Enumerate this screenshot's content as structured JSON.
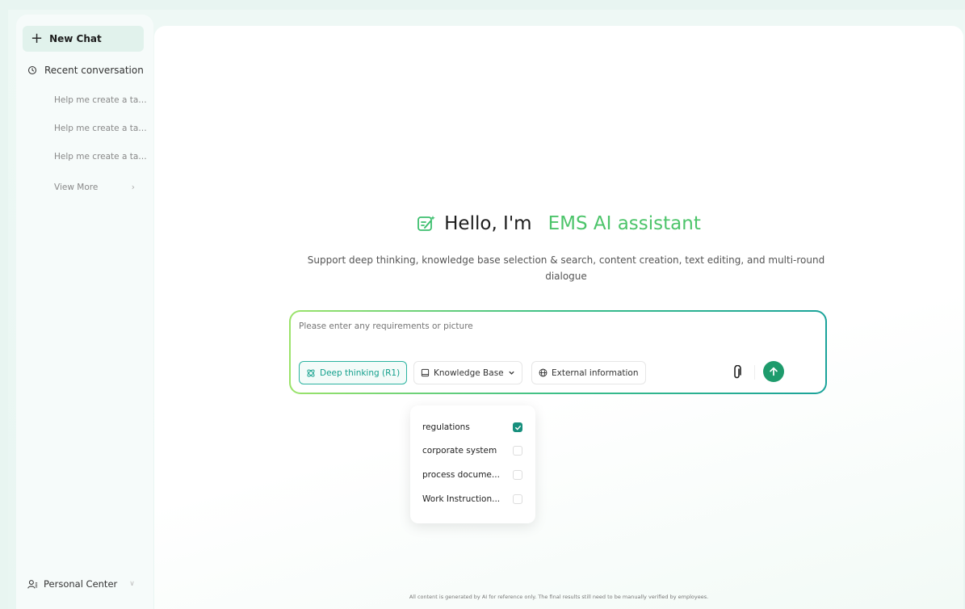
{
  "sidebar": {
    "new_chat": "New Chat",
    "recent_title": "Recent conversation",
    "recent_items": [
      "Help me create a tan...",
      "Help me create a tan...",
      "Help me create a tan..."
    ],
    "view_more": "View More",
    "personal": "Personal Center"
  },
  "main": {
    "hello": "Hello, I'm",
    "brand": "EMS AI assistant",
    "subtitle": "Support deep thinking, knowledge base selection & search, content creation, text editing, and multi-round dialogue",
    "input_placeholder": "Please enter any requirements or picture",
    "chips": {
      "deep": "Deep thinking (R1)",
      "kb": "Knowledge Base",
      "ext": "External information"
    },
    "kb_options": [
      {
        "label": "regulations",
        "checked": true
      },
      {
        "label": "corporate system",
        "checked": false
      },
      {
        "label": "process docume...",
        "checked": false
      },
      {
        "label": "Work Instruction...",
        "checked": false
      }
    ],
    "disclaimer": "All content is generated by AI for reference only. The final results still need to be manually verified by employees."
  },
  "colors": {
    "brand": "#4cc46a",
    "accent": "#1e9b6c",
    "checkbox": "#178f7d"
  }
}
